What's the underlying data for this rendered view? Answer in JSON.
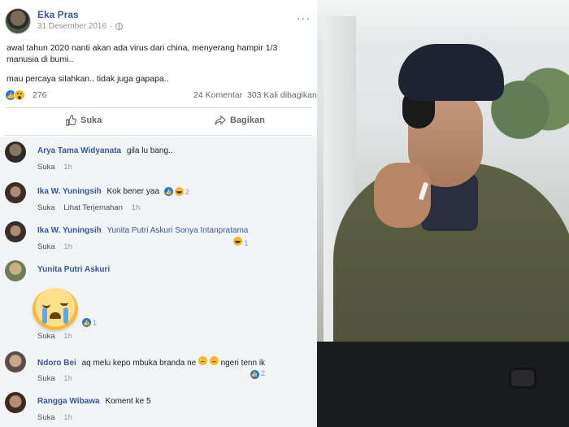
{
  "post": {
    "author": "Eka Pras",
    "date": "31 Desember 2016",
    "privacy_icon": "globe-icon",
    "more_icon": "ellipsis-icon",
    "paragraphs": [
      "awal tahun 2020 nanti akan ada virus dari china, menyerang hampir 1/3 manusia di bumi..",
      "mau percaya silahkan.. tidak juga gapapa.."
    ],
    "reaction_count": "276",
    "comment_count": "24 Komentar",
    "share_count": "303 Kali dibagikan"
  },
  "actions": {
    "like_label": "Suka",
    "share_label": "Bagikan"
  },
  "comments": [
    {
      "name": "Arya Tama Widyanata",
      "text": "gila lu bang..",
      "meta_like": "Suka",
      "meta_time": "1h"
    },
    {
      "name": "Ika W. Yuningsih",
      "text": "Kok bener yaa",
      "reaction_count": "2",
      "meta_like": "Suka",
      "meta_translate": "Lihat Terjemahan",
      "meta_time": "1h"
    },
    {
      "name": "Ika W. Yuningsih",
      "text": "Yunita Putri Askuri Sonya Intanpratama",
      "reaction_count": "1",
      "meta_like": "Suka",
      "meta_time": "1h"
    },
    {
      "name": "Yunita Putri Askuri",
      "text": "",
      "reaction_count": "1",
      "meta_like": "Suka",
      "meta_time": "1h"
    },
    {
      "name": "Ndoro Bei",
      "text": "aq melu kepo mbuka branda ne",
      "text_after": "ngeri tenn ik",
      "reaction_count": "2",
      "meta_like": "Suka",
      "meta_time": "1h"
    },
    {
      "name": "Rangga Wibawa",
      "text": "Koment ke 5",
      "meta_like": "Suka",
      "meta_time": "1h"
    }
  ],
  "colors": {
    "link_blue": "#385898",
    "like_blue": "#1877f2",
    "muted_text": "#90949c",
    "comment_bg": "#f2f3f5"
  }
}
